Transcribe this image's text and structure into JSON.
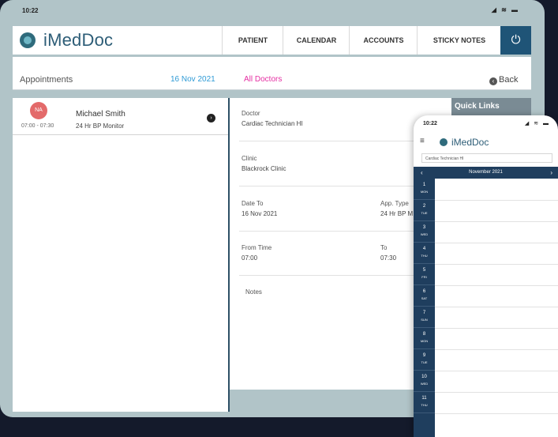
{
  "tablet": {
    "status_time": "10:22",
    "status_icons": "◢ ≋ ▬",
    "logo_text": "iMedDoc",
    "nav": [
      "PATIENT",
      "CALENDAR",
      "ACCOUNTS",
      "STICKY NOTES"
    ],
    "power_icon": "⏻",
    "appointments_title": "Appointments",
    "date": "16 Nov 2021",
    "doctor_filter": "All Doctors",
    "back_label": "Back",
    "quick_links": "Quick Links",
    "appointment": {
      "initials": "NA",
      "time": "07:00 - 07:30",
      "name": "Michael Smith",
      "type": "24 Hr BP Monitor"
    },
    "details": {
      "doctor_label": "Doctor",
      "doctor_value": "Cardiac Technician HI",
      "clinic_label": "Clinic",
      "clinic_value": "Blackrock Clinic",
      "date_label": "Date To",
      "date_value": "16 Nov 2021",
      "type_label": "App. Type",
      "type_value": "24 Hr BP M",
      "from_label": "From Time",
      "from_value": "07:00",
      "to_label": "To",
      "to_value": "07:30",
      "notes_label": "Notes"
    }
  },
  "phone": {
    "status_time": "10:22",
    "status_icons": "◢ ≋ ▬",
    "menu_icon": "≡",
    "logo_text": "iMedDoc",
    "search_value": "Cardiac Technician HI",
    "month": "November 2021",
    "prev_icon": "‹",
    "next_icon": "›",
    "days": [
      {
        "n": "1",
        "w": "MON"
      },
      {
        "n": "2",
        "w": "TUE"
      },
      {
        "n": "3",
        "w": "WED"
      },
      {
        "n": "4",
        "w": "THU"
      },
      {
        "n": "5",
        "w": "FRI"
      },
      {
        "n": "6",
        "w": "SAT"
      },
      {
        "n": "7",
        "w": "SUN"
      },
      {
        "n": "8",
        "w": "MON"
      },
      {
        "n": "9",
        "w": "TUE"
      },
      {
        "n": "10",
        "w": "WED"
      },
      {
        "n": "11",
        "w": "THU"
      }
    ]
  }
}
